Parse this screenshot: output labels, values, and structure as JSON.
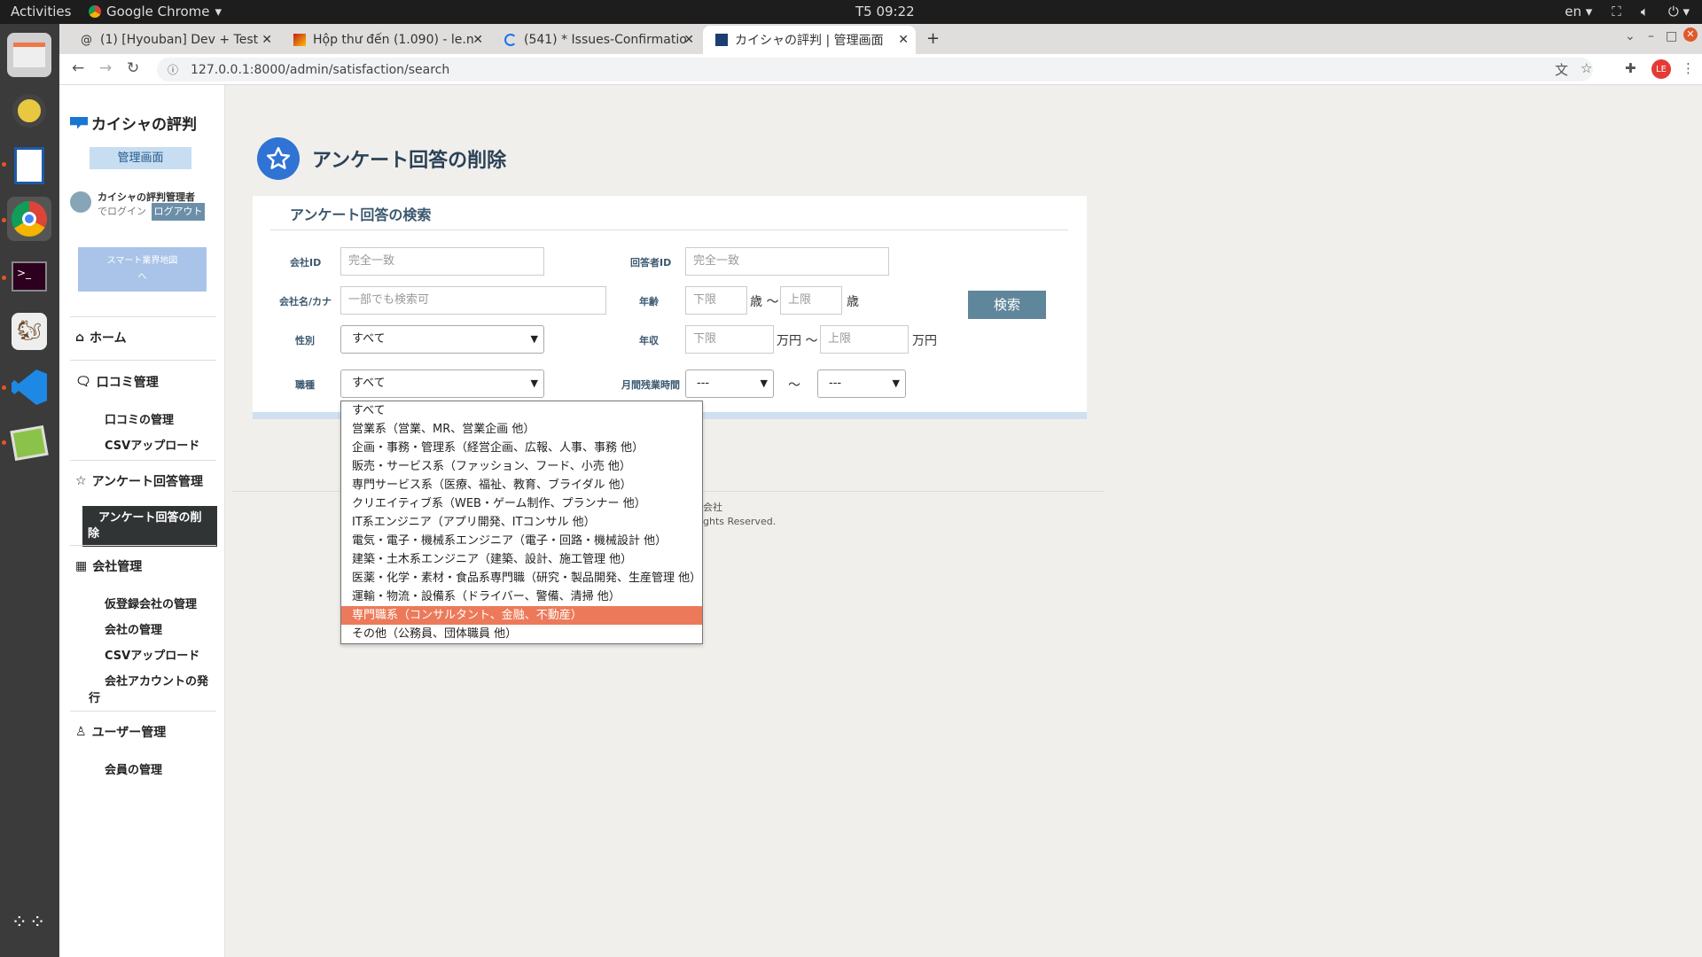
{
  "os": {
    "activities": "Activities",
    "app_name": "Google Chrome",
    "clock": "T5 09:22",
    "lang": "en"
  },
  "browser": {
    "tabs": [
      {
        "label": "(1) [Hyouban] Dev + Test"
      },
      {
        "label": "Hộp thư đến (1.090) - le.n"
      },
      {
        "label": "(541) * Issues-Confirmatio"
      },
      {
        "label": "カイシャの評判 | 管理画面"
      }
    ],
    "url": "127.0.0.1:8000/admin/satisfaction/search",
    "profile_initials": "LE"
  },
  "sidebar": {
    "logo_text": "カイシャの評判",
    "admin_badge": "管理画面",
    "user_name": "カイシャの評判管理者",
    "login_text": "でログイン",
    "logout_label": "ログアウト",
    "smart_line1": "スマート業界地図",
    "smart_line2": "へ",
    "home": "ホーム",
    "kuchikomi": "口コミ管理",
    "kuchikomi_sub1": "口コミの管理",
    "kuchikomi_sub2": "CSVアップロード",
    "enquete": "アンケート回答管理",
    "enquete_sub1_line1": "アンケート回答の削",
    "enquete_sub1_line2": "除",
    "company": "会社管理",
    "company_sub1": "仮登録会社の管理",
    "company_sub2": "会社の管理",
    "company_sub3": "CSVアップロード",
    "company_sub4_line1": "会社アカウントの発",
    "company_sub4_line2": "行",
    "user": "ユーザー管理",
    "user_sub1": "会員の管理"
  },
  "main": {
    "title": "アンケート回答の削除",
    "panel_title": "アンケート回答の検索",
    "labels": {
      "company_id": "会社ID",
      "respondent_id": "回答者ID",
      "company_name": "会社名/カナ",
      "age": "年齢",
      "gender": "性別",
      "income": "年収",
      "job": "職種",
      "overtime": "月間残業時間"
    },
    "placeholders": {
      "company_id": "完全一致",
      "respondent_id": "完全一致",
      "company_name": "一部でも検索可",
      "age_min": "下限",
      "age_max": "上限",
      "income_min": "下限",
      "income_max": "上限"
    },
    "units": {
      "age_tilde": "歳 〜",
      "age_end": "歳",
      "income_tilde": "万円 〜",
      "income_end": "万円",
      "overtime_tilde": "〜"
    },
    "gender_value": "すべて",
    "job_value": "すべて",
    "overtime_min_value": "---",
    "overtime_max_value": "---",
    "search_button": "検索",
    "job_options": [
      "すべて",
      "営業系（営業、MR、営業企画 他）",
      "企画・事務・管理系（経営企画、広報、人事、事務 他）",
      "販売・サービス系（ファッション、フード、小売 他）",
      "専門サービス系（医療、福祉、教育、ブライダル 他）",
      "クリエイティブ系（WEB・ゲーム制作、プランナー 他）",
      "IT系エンジニア（アプリ開発、ITコンサル 他）",
      "電気・電子・機械系エンジニア（電子・回路・機械設計 他）",
      "建築・土木系エンジニア（建築、設計、施工管理 他）",
      "医薬・化学・素材・食品系専門職（研究・製品開発、生産管理 他）",
      "運輸・物流・設備系（ドライバー、警備、清掃 他）",
      "専門職系（コンサルタント、金融、不動産）",
      "その他（公務員、団体職員 他）"
    ],
    "footer_line1": "会社",
    "footer_line2": "ghts Reserved."
  },
  "colors": {
    "accent": "#2f73d4",
    "highlight": "#ec7a5a",
    "button": "#60869b"
  }
}
